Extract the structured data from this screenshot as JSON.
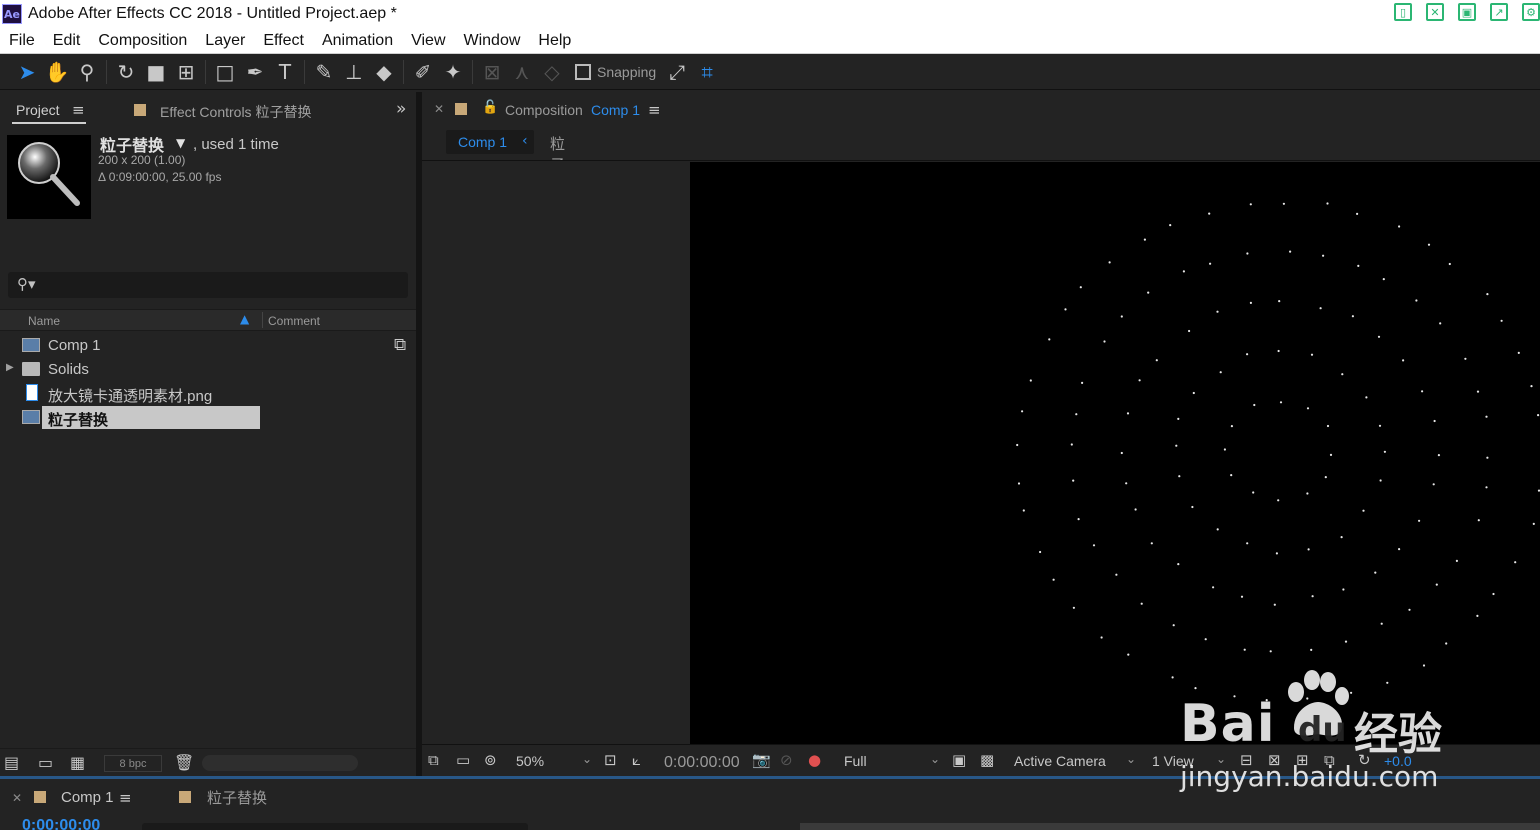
{
  "window": {
    "logo_text": "Ae",
    "title": "Adobe After Effects CC 2018 - Untitled Project.aep *"
  },
  "menu": [
    "File",
    "Edit",
    "Composition",
    "Layer",
    "Effect",
    "Animation",
    "View",
    "Window",
    "Help"
  ],
  "toolbar": {
    "snapping_label": "Snapping",
    "snapping_checked": false
  },
  "project_panel": {
    "tab_label": "Project",
    "effect_controls_label": "Effect Controls 粒子替换",
    "selected_item": {
      "name": "粒子替换",
      "usage": ", used 1 time",
      "dimensions": "200 x 200 (1.00)",
      "duration": "Δ 0:09:00:00, 25.00 fps"
    },
    "columns": {
      "name": "Name",
      "comment": "Comment"
    },
    "items": [
      {
        "label": "Comp 1",
        "type": "comp",
        "selected": false
      },
      {
        "label": "Solids",
        "type": "folder",
        "selected": false
      },
      {
        "label": "放大镜卡通透明素材.png",
        "type": "png",
        "selected": false
      },
      {
        "label": "粒子替换",
        "type": "comp",
        "selected": true
      }
    ],
    "bpc": "8 bpc"
  },
  "composition_panel": {
    "tab_label": "Composition",
    "tab_comp_name": "Comp 1",
    "breadcrumb_active": "Comp 1",
    "breadcrumb_next": "粒子替换",
    "zoom": "50%",
    "timecode": "0:00:00:00",
    "resolution": "Full",
    "camera": "Active Camera",
    "views": "1 View",
    "exposure": "+0.0"
  },
  "timeline": {
    "tab_label": "Comp 1",
    "tab2_label": "粒子替换",
    "timecode": "0:00:00:00"
  },
  "watermark": {
    "brand_bai": "Bai",
    "brand_du": "du",
    "brand_cn": "经验",
    "url": "jingyan.baidu.com"
  },
  "colors": {
    "accent": "#2d8ceb",
    "panel_bg": "#232323",
    "label_tan": "#c8a878"
  }
}
